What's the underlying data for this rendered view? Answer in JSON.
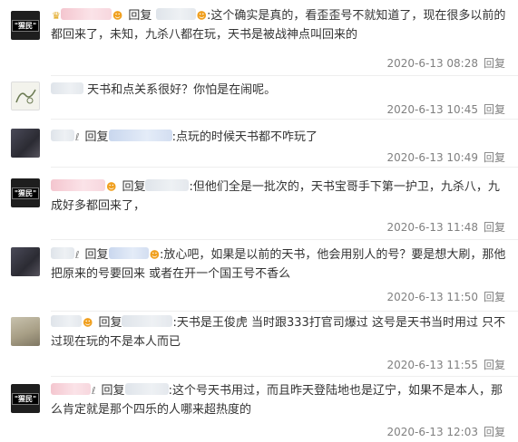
{
  "comments": [
    {
      "reply_word": "回复",
      "content": ":这个确实是真的，看歪歪号不就知道了，现在很多以前的都回来了，未知，九杀八都在玩，天书是被战神点叫回来的",
      "time": "2020-6-13 08:28",
      "reply_link": "回复",
      "avatar_text": "\"猩民\""
    },
    {
      "content": "天书和点关系很好？你怕是在闹呢。",
      "time": "2020-6-13 10:45",
      "reply_link": "回复"
    },
    {
      "reply_word": "回复",
      "content": ":点玩的时候天书都不咋玩了",
      "time": "2020-6-13 10:49",
      "reply_link": "回复"
    },
    {
      "reply_word": "回复",
      "content": ":但他们全是一批次的，天书宝哥手下第一护卫，九杀八，九成好多都回来了，",
      "time": "2020-6-13 11:48",
      "reply_link": "回复",
      "avatar_text": "\"猩民\""
    },
    {
      "reply_word": "回复",
      "content": ":放心吧，如果是以前的天书，他会用别人的号？要是想大刷，那他把原来的号要回来 或者在开一个国王号不香么",
      "time": "2020-6-13 11:50",
      "reply_link": "回复"
    },
    {
      "reply_word": "回复",
      "content": ":天书是王俊虎 当时跟333打官司爆过 这号是天书当时用过 只不过现在玩的不是本人而已",
      "time": "2020-6-13 11:55",
      "reply_link": "回复"
    },
    {
      "reply_word": "回复",
      "content": ":这个号天书用过，而且昨天登陆地也是辽宁，如果不是本人，那么肯定就是那个四乐的人哪来超热度的",
      "time": "2020-6-13 12:03",
      "reply_link": "回复",
      "avatar_text": "\"猩民\""
    }
  ]
}
